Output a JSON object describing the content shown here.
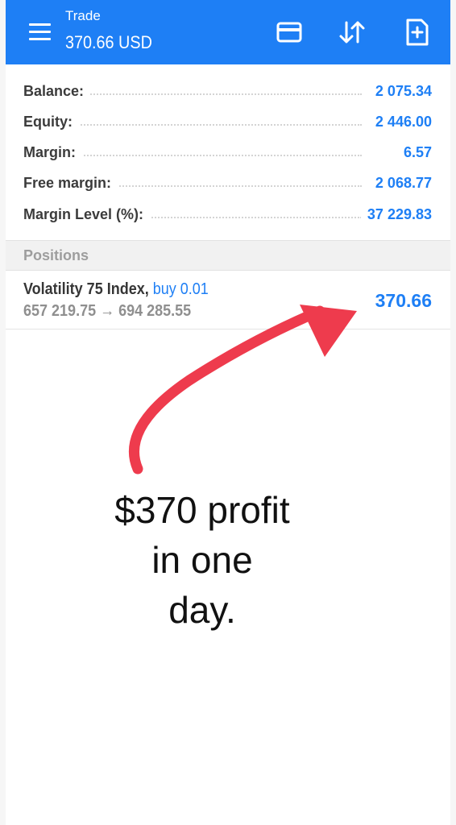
{
  "header": {
    "title": "Trade",
    "subtitle": "370.66 USD"
  },
  "summary": [
    {
      "label": "Balance:",
      "value": "2 075.34"
    },
    {
      "label": "Equity:",
      "value": "2 446.00"
    },
    {
      "label": "Margin:",
      "value": "6.57"
    },
    {
      "label": "Free margin:",
      "value": "2 068.77"
    },
    {
      "label": "Margin Level (%):",
      "value": "37 229.83"
    }
  ],
  "positions": {
    "section_label": "Positions",
    "items": [
      {
        "symbol": "Volatility 75 Index,",
        "side": "buy 0.01",
        "prices": "657 219.75 → 694 285.55",
        "profit": "370.66"
      }
    ]
  },
  "annotation": {
    "line1": "$370 profit",
    "line2": "in one",
    "line3": "day."
  },
  "icons": {
    "menu": "menu-icon",
    "card": "credit-card-icon",
    "sort": "sort-arrows-icon",
    "new_order": "new-document-icon",
    "arrow": "red-annotation-arrow"
  },
  "colors": {
    "accent": "#1e7ff5",
    "arrow": "#ee3b4d"
  }
}
